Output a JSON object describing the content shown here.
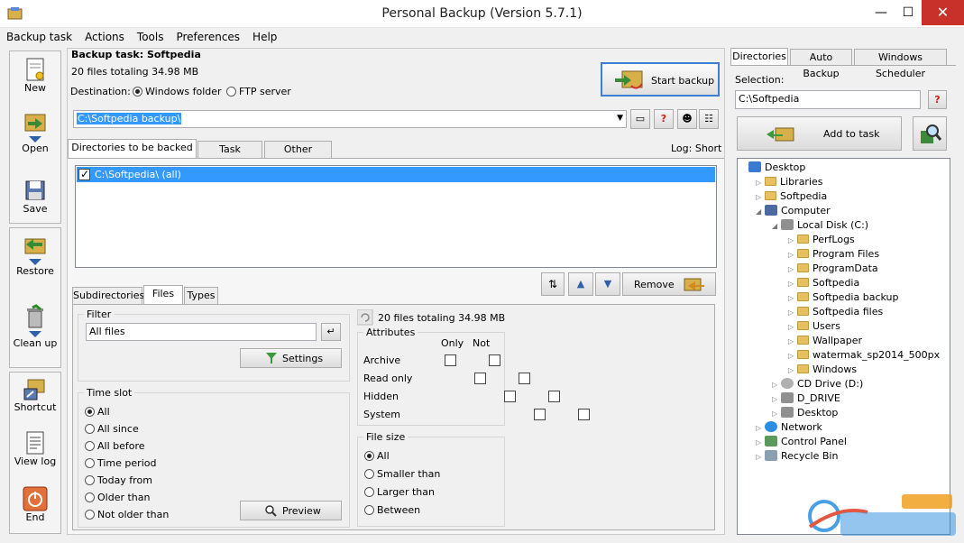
{
  "window": {
    "title": "Personal Backup (Version 5.7.1)",
    "min": "—",
    "max": "☐",
    "close": "✕"
  },
  "menu": [
    "Backup task",
    "Actions",
    "Tools",
    "Preferences",
    "Help"
  ],
  "toolbar": {
    "new": "New",
    "open": "Open",
    "save": "Save",
    "restore": "Restore",
    "cleanup": "Clean up",
    "shortcut": "Shortcut",
    "viewlog": "View log",
    "end": "End"
  },
  "task": {
    "title": "Backup task: Softpedia",
    "summary": "20 files totaling 34.98 MB",
    "destination_label": "Destination:",
    "dest_windows": "Windows folder",
    "dest_ftp": "FTP server",
    "dest_path": "C:\\Softpedia backup\\",
    "start_backup": "Start backup",
    "help": "?",
    "log": "Log: Short"
  },
  "main_tabs": [
    "Directories to be backed up",
    "Task settings",
    "Other options"
  ],
  "directories": [
    {
      "label": "C:\\Softpedia\\ (all)",
      "checked": true
    }
  ],
  "remove": "Remove",
  "sub_tabs": [
    "Subdirectories",
    "Files",
    "Types"
  ],
  "filter": {
    "title": "Filter",
    "value": "All files",
    "settings": "Settings"
  },
  "timeslot": {
    "title": "Time slot",
    "options": [
      "All",
      "All since",
      "All before",
      "Time period",
      "Today from",
      "Older than",
      "Not older than"
    ],
    "selected": 0,
    "preview": "Preview"
  },
  "files_info": "20 files totaling 34.98 MB",
  "attributes": {
    "title": "Attributes",
    "col_only": "Only",
    "col_not": "Not",
    "rows": [
      "Archive",
      "Read only",
      "Hidden",
      "System"
    ]
  },
  "filesize": {
    "title": "File size",
    "options": [
      "All",
      "Smaller than",
      "Larger than",
      "Between"
    ],
    "selected": 0
  },
  "right_tabs": [
    "Directories",
    "Auto Backup",
    "Windows Scheduler"
  ],
  "selection": {
    "label": "Selection:",
    "value": "C:\\Softpedia",
    "help": "?",
    "add_to_task": "Add to task"
  },
  "tree": [
    {
      "label": "Desktop",
      "level": 0,
      "icon": "desktop",
      "tw": ""
    },
    {
      "label": "Libraries",
      "level": 1,
      "icon": "folder",
      "tw": "▷"
    },
    {
      "label": "Softpedia",
      "level": 1,
      "icon": "folder",
      "tw": "▷"
    },
    {
      "label": "Computer",
      "level": 1,
      "icon": "computer",
      "tw": "◢"
    },
    {
      "label": "Local Disk (C:)",
      "level": 2,
      "icon": "drive",
      "tw": "◢"
    },
    {
      "label": "PerfLogs",
      "level": 3,
      "icon": "folder",
      "tw": "▷"
    },
    {
      "label": "Program Files",
      "level": 3,
      "icon": "folder",
      "tw": "▷"
    },
    {
      "label": "ProgramData",
      "level": 3,
      "icon": "folder",
      "tw": "▷"
    },
    {
      "label": "Softpedia",
      "level": 3,
      "icon": "folder",
      "tw": "▷"
    },
    {
      "label": "Softpedia backup",
      "level": 3,
      "icon": "folder",
      "tw": "▷"
    },
    {
      "label": "Softpedia files",
      "level": 3,
      "icon": "folder",
      "tw": "▷"
    },
    {
      "label": "Users",
      "level": 3,
      "icon": "folder",
      "tw": "▷"
    },
    {
      "label": "Wallpaper",
      "level": 3,
      "icon": "folder",
      "tw": "▷"
    },
    {
      "label": "watermak_sp2014_500px",
      "level": 3,
      "icon": "folder",
      "tw": "▷"
    },
    {
      "label": "Windows",
      "level": 3,
      "icon": "folder",
      "tw": "▷"
    },
    {
      "label": "CD Drive (D:)",
      "level": 2,
      "icon": "cd",
      "tw": "▷"
    },
    {
      "label": "D_DRIVE",
      "level": 2,
      "icon": "drive",
      "tw": "▷"
    },
    {
      "label": "Desktop",
      "level": 2,
      "icon": "drive",
      "tw": "▷"
    },
    {
      "label": "Network",
      "level": 1,
      "icon": "network",
      "tw": "▷"
    },
    {
      "label": "Control Panel",
      "level": 1,
      "icon": "control",
      "tw": "▷"
    },
    {
      "label": "Recycle Bin",
      "level": 1,
      "icon": "recycle",
      "tw": "▷"
    }
  ],
  "colors": {
    "selection": "#3399ff",
    "close": "#c7312a",
    "folder": "#e8c060"
  }
}
